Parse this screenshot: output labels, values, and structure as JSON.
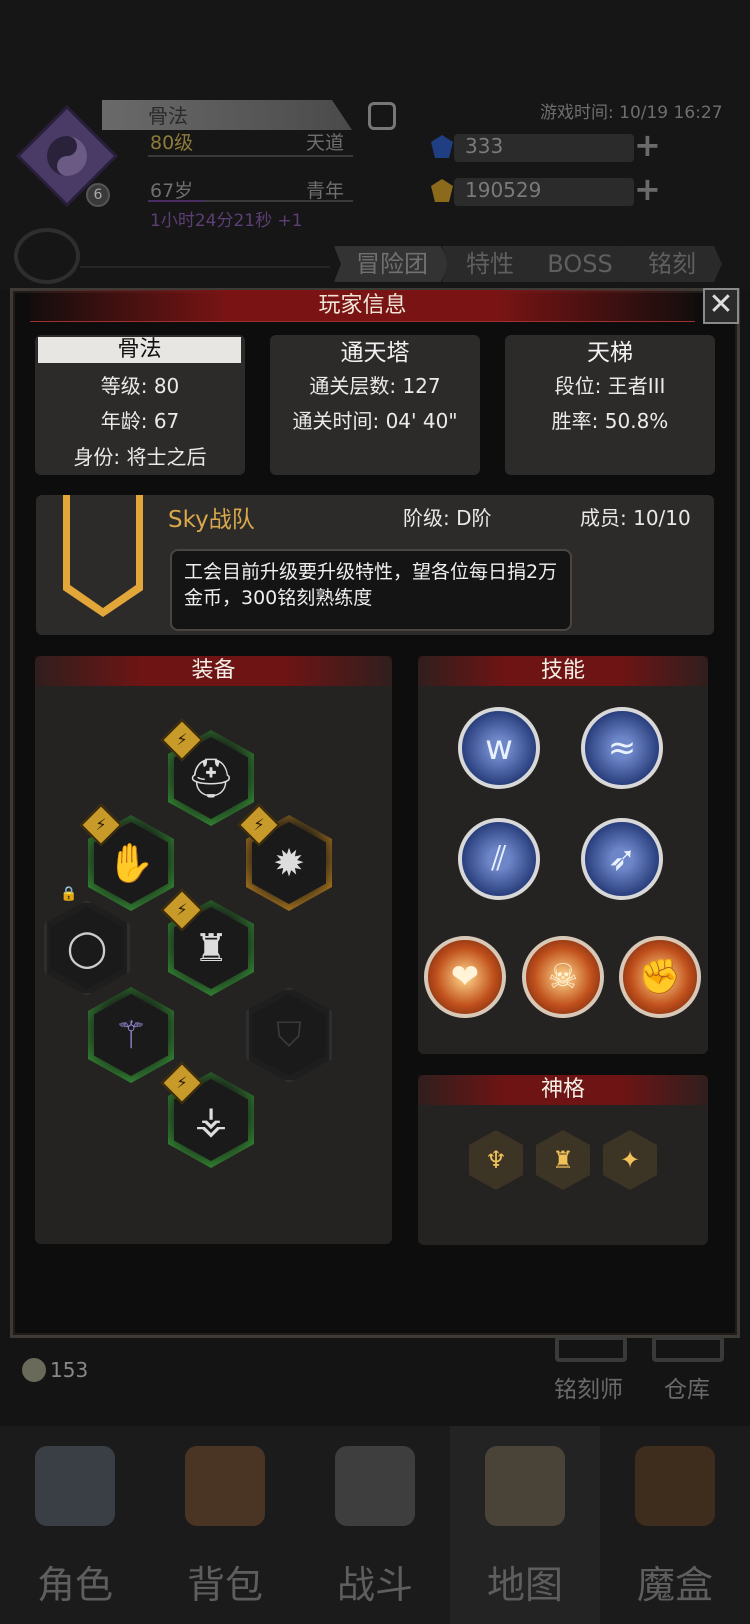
{
  "header": {
    "player_name": "骨法",
    "avatar_level": "6",
    "level": "80级",
    "realm": "天道",
    "age": "67岁",
    "age_stage": "青年",
    "timer": "1小时24分21秒 +1",
    "game_time": "游戏时间: 10/19 16:27",
    "resources": [
      {
        "name": "blue-gem",
        "value": "333",
        "color": "#2b5ab8"
      },
      {
        "name": "gold-gem",
        "value": "190529",
        "color": "#c99b2a"
      }
    ],
    "tabs": [
      "冒险团",
      "特性",
      "BOSS",
      "铭刻"
    ]
  },
  "modal": {
    "title": "玩家信息",
    "close_label": "✕",
    "profile": {
      "name": "骨法",
      "level_label": "等级: 80",
      "age_label": "年龄: 67",
      "identity_label": "身份: 将士之后"
    },
    "tower": {
      "title": "通天塔",
      "floors": "通关层数: 127",
      "time": "通关时间: 04' 40\""
    },
    "ladder": {
      "title": "天梯",
      "rank": "段位: 王者III",
      "winrate": "胜率: 50.8%"
    },
    "guild": {
      "name": "Sky战队",
      "grade": "阶级: D阶",
      "members": "成员: 10/10",
      "notice": "工会目前升级要升级特性，望各位每日捐2万金币，300铭刻熟练度"
    },
    "equipment": {
      "title": "装备",
      "slots": [
        {
          "name": "helmet",
          "glyph": "⛑",
          "rarity": "green"
        },
        {
          "name": "gauntlet",
          "glyph": "✋",
          "rarity": "green"
        },
        {
          "name": "flail",
          "glyph": "✹",
          "rarity": "gold"
        },
        {
          "name": "belt",
          "glyph": "◯",
          "rarity": "locked"
        },
        {
          "name": "armor",
          "glyph": "♜",
          "rarity": "green"
        },
        {
          "name": "whip",
          "glyph": "⚚",
          "rarity": "green"
        },
        {
          "name": "shield-slot",
          "glyph": "⛉",
          "rarity": "empty"
        },
        {
          "name": "greaves",
          "glyph": "⚶",
          "rarity": "green"
        }
      ]
    },
    "skills": {
      "title": "技能",
      "items": [
        {
          "name": "fang-skill",
          "glyph": "ᴡ",
          "type": "blue"
        },
        {
          "name": "wave-skill",
          "glyph": "≈",
          "type": "blue"
        },
        {
          "name": "claw-skill",
          "glyph": "⫽",
          "type": "blue"
        },
        {
          "name": "strike-skill",
          "glyph": "➶",
          "type": "blue"
        },
        {
          "name": "heart-hands-skill",
          "glyph": "❤",
          "type": "orange"
        },
        {
          "name": "skull-skill",
          "glyph": "☠",
          "type": "orange"
        },
        {
          "name": "shield-fist-skill",
          "glyph": "✊",
          "type": "orange"
        }
      ]
    },
    "divinity": {
      "title": "神格",
      "items": [
        {
          "name": "tree-divinity",
          "glyph": "♆"
        },
        {
          "name": "tower-divinity",
          "glyph": "♜"
        },
        {
          "name": "star-divinity",
          "glyph": "✦"
        }
      ]
    }
  },
  "footer": {
    "coin_count": "153",
    "engraver": "铭刻师",
    "warehouse": "仓库"
  },
  "nav": [
    {
      "label": "角色",
      "icon": "helmet-icon",
      "color": "#4a5058"
    },
    {
      "label": "背包",
      "icon": "backpack-icon",
      "color": "#6a4a32"
    },
    {
      "label": "战斗",
      "icon": "sword-shield-icon",
      "color": "#5a5a5a"
    },
    {
      "label": "地图",
      "icon": "scroll-map-icon",
      "color": "#6e6250"
    },
    {
      "label": "魔盒",
      "icon": "magic-box-icon",
      "color": "#5a3e26"
    }
  ]
}
